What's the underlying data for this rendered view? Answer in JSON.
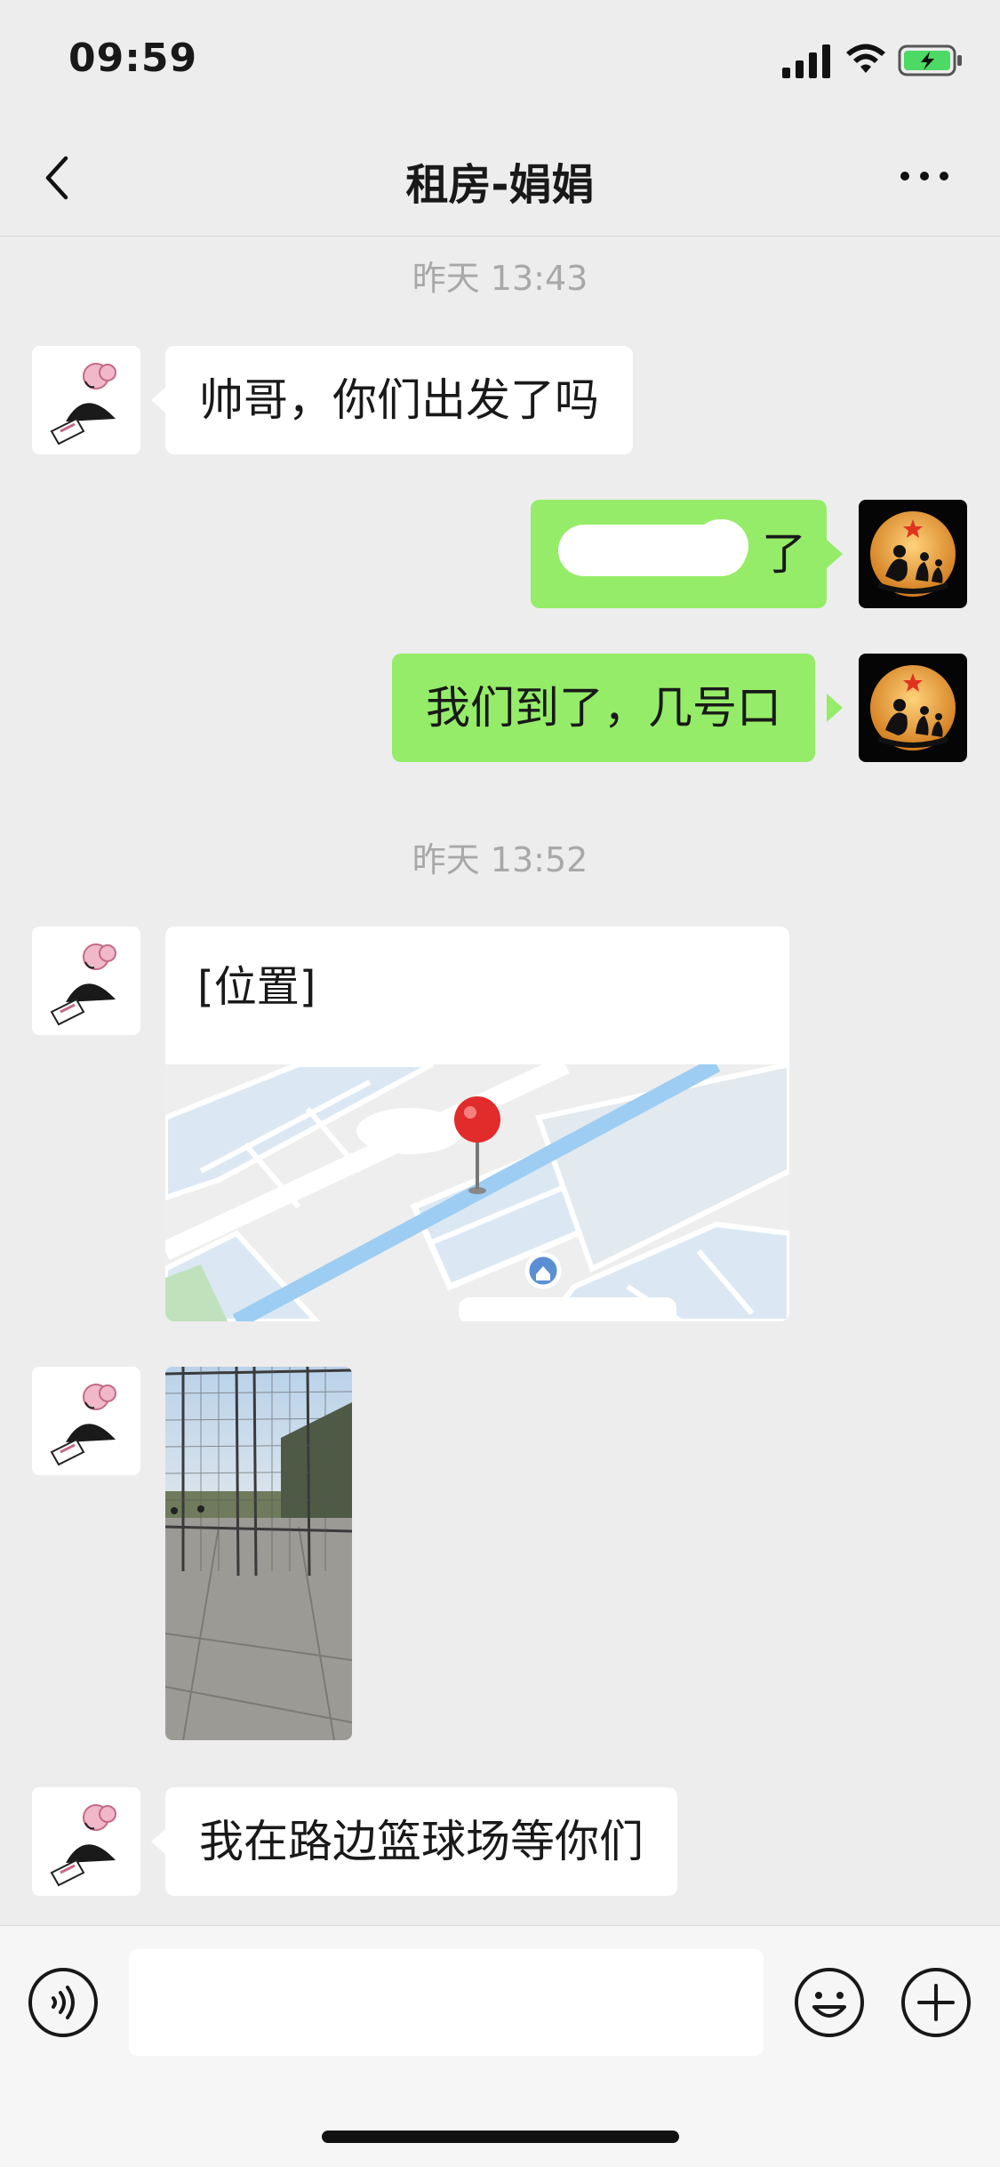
{
  "status_bar": {
    "time": "09:59",
    "icons": [
      "signal-icon",
      "wifi-icon",
      "battery-charging-icon"
    ]
  },
  "nav": {
    "title": "租房-娟娟",
    "back_icon": "chevron-left-icon",
    "more_icon": "more-icon"
  },
  "messages": {
    "ts1": "昨天 13:43",
    "m1": "帅哥，你们出发了吗",
    "m2_tail": "了",
    "m3": "我们到了，几号口",
    "ts2": "昨天 13:52",
    "location_label": "[位置]",
    "m6": "我在路边篮球场等你们"
  },
  "input_bar": {
    "icons": [
      "voice-icon",
      "emoji-icon",
      "plus-icon"
    ],
    "text_value": ""
  },
  "colors": {
    "background": "#ededed",
    "outgoing_bubble": "#95ec69",
    "incoming_bubble": "#ffffff",
    "timestamp": "#a8a8a8",
    "map_road": "#9dcdf2",
    "pin": "#e22b2b"
  }
}
